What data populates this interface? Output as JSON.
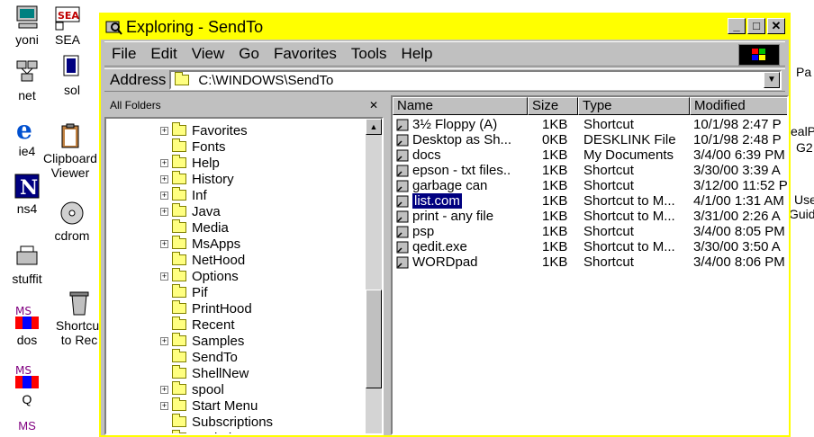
{
  "desktop": {
    "icons": [
      {
        "label": "yoni"
      },
      {
        "label": "SEA"
      },
      {
        "label": "net"
      },
      {
        "label": "sol"
      },
      {
        "label": "ie4"
      },
      {
        "label": "Clipboard Viewer"
      },
      {
        "label": "ns4"
      },
      {
        "label": "cdrom"
      },
      {
        "label": "stuffit"
      },
      {
        "label": "dos"
      },
      {
        "label": "Shortcut to Rec"
      },
      {
        "label": "Q"
      },
      {
        "label": "MS"
      }
    ],
    "right_strip": [
      "Pa",
      "ealP",
      "G2",
      "Use",
      "Guid"
    ]
  },
  "window": {
    "title": "Exploring - SendTo",
    "controls": {
      "minimize": "_",
      "maximize": "□",
      "close": "✕"
    },
    "menus": [
      {
        "label": "File"
      },
      {
        "label": "Edit"
      },
      {
        "label": "View"
      },
      {
        "label": "Go"
      },
      {
        "label": "Favorites"
      },
      {
        "label": "Tools"
      },
      {
        "label": "Help"
      }
    ],
    "address": {
      "label": "Address",
      "value": "C:\\WINDOWS\\SendTo"
    }
  },
  "tree": {
    "header": "All Folders",
    "close": "✕",
    "items": [
      {
        "name": "Favorites",
        "expandable": true
      },
      {
        "name": "Fonts",
        "expandable": false
      },
      {
        "name": "Help",
        "expandable": true
      },
      {
        "name": "History",
        "expandable": true
      },
      {
        "name": "Inf",
        "expandable": true
      },
      {
        "name": "Java",
        "expandable": true
      },
      {
        "name": "Media",
        "expandable": false
      },
      {
        "name": "MsApps",
        "expandable": true
      },
      {
        "name": "NetHood",
        "expandable": false
      },
      {
        "name": "Options",
        "expandable": true
      },
      {
        "name": "Pif",
        "expandable": false
      },
      {
        "name": "PrintHood",
        "expandable": false
      },
      {
        "name": "Recent",
        "expandable": false
      },
      {
        "name": "Samples",
        "expandable": true
      },
      {
        "name": "SendTo",
        "expandable": false
      },
      {
        "name": "ShellNew",
        "expandable": false
      },
      {
        "name": "spool",
        "expandable": true
      },
      {
        "name": "Start Menu",
        "expandable": true
      },
      {
        "name": "Subscriptions",
        "expandable": false
      },
      {
        "name": "Sysbckup",
        "expandable": false
      }
    ]
  },
  "list": {
    "columns": [
      "Name",
      "Size",
      "Type",
      "Modified"
    ],
    "rows": [
      {
        "name": "3½ Floppy (A)",
        "size": "1KB",
        "type": "Shortcut",
        "modified": "10/1/98 2:47 P"
      },
      {
        "name": "Desktop as Sh...",
        "size": "0KB",
        "type": "DESKLINK File",
        "modified": "10/1/98 2:48 P"
      },
      {
        "name": "docs",
        "size": "1KB",
        "type": "My Documents",
        "modified": "3/4/00 6:39 PM"
      },
      {
        "name": "epson - txt files..",
        "size": "1KB",
        "type": "Shortcut",
        "modified": "3/30/00 3:39 A"
      },
      {
        "name": "garbage can",
        "size": "1KB",
        "type": "Shortcut",
        "modified": "3/12/00 11:52 P"
      },
      {
        "name": "list.com",
        "size": "1KB",
        "type": "Shortcut to M...",
        "modified": "4/1/00 1:31 AM",
        "selected": true
      },
      {
        "name": "print - any file",
        "size": "1KB",
        "type": "Shortcut to M...",
        "modified": "3/31/00 2:26 A"
      },
      {
        "name": "psp",
        "size": "1KB",
        "type": "Shortcut",
        "modified": "3/4/00 8:05 PM"
      },
      {
        "name": "qedit.exe",
        "size": "1KB",
        "type": "Shortcut to M...",
        "modified": "3/30/00 3:50 A"
      },
      {
        "name": "WORDpad",
        "size": "1KB",
        "type": "Shortcut",
        "modified": "3/4/00 8:06 PM"
      }
    ]
  },
  "colors": {
    "title_bar": "#ffff00",
    "selection": "#000080",
    "face": "#c0c0c0"
  }
}
